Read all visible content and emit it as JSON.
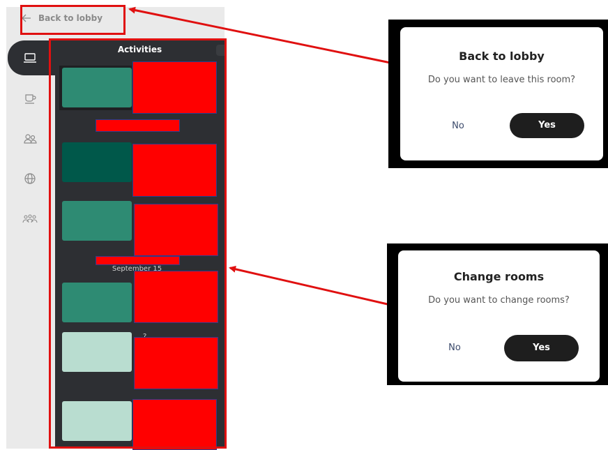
{
  "app": {
    "back_label": "Back to lobby",
    "activities_title": "Activities",
    "date_label_2": "September 15",
    "stray_char": "?"
  },
  "rail": {
    "items": [
      {
        "icon": "laptop-icon",
        "active": true
      },
      {
        "icon": "coffee-icon",
        "active": false
      },
      {
        "icon": "people-icon",
        "active": false
      },
      {
        "icon": "globe-icon",
        "active": false
      },
      {
        "icon": "group-icon",
        "active": false
      }
    ]
  },
  "dialogs": {
    "back_to_lobby": {
      "title": "Back to lobby",
      "message": "Do you want to leave this room?",
      "no_label": "No",
      "yes_label": "Yes"
    },
    "change_rooms": {
      "title": "Change rooms",
      "message": "Do you want to change rooms?",
      "no_label": "No",
      "yes_label": "Yes"
    }
  },
  "colors": {
    "highlight": "#e01010",
    "panel_dark": "#2d2f33",
    "thumb_green": "#2e8b73",
    "thumb_dark_green": "#00584a",
    "thumb_light": "#b9ddd0",
    "redaction": "#ff0000"
  }
}
